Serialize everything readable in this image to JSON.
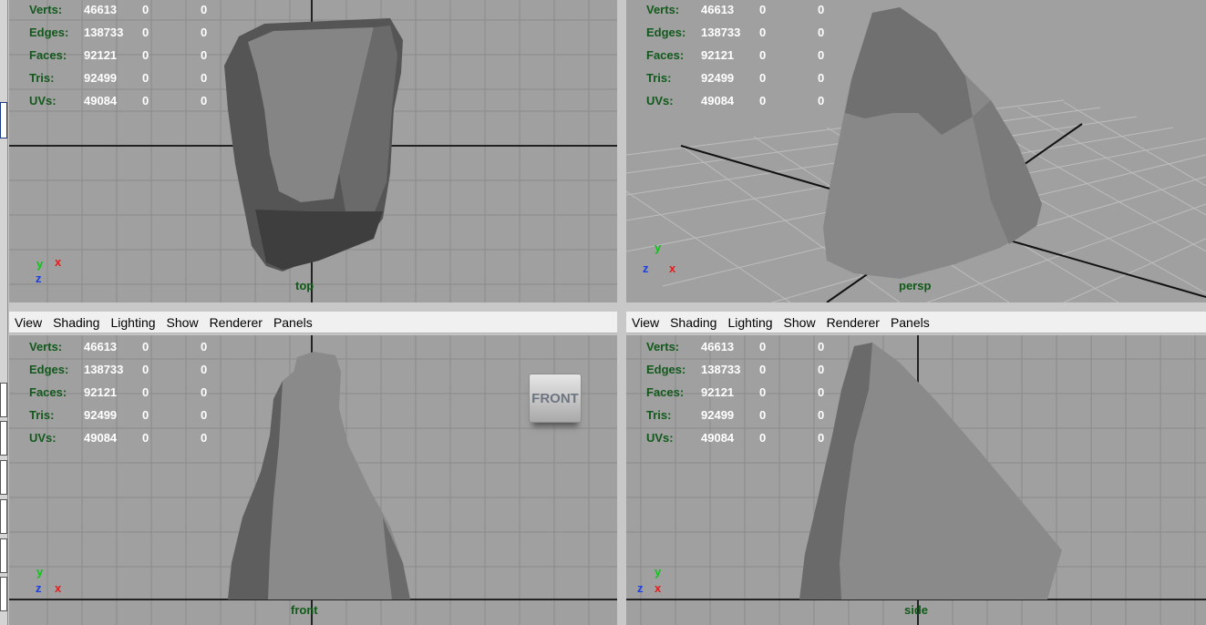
{
  "menu": [
    "View",
    "Shading",
    "Lighting",
    "Show",
    "Renderer",
    "Panels"
  ],
  "hud": {
    "labels": [
      "Verts:",
      "Edges:",
      "Faces:",
      "Tris:",
      "UVs:"
    ],
    "values": [
      [
        "46613",
        "0",
        "0"
      ],
      [
        "138733",
        "0",
        "0"
      ],
      [
        "92121",
        "0",
        "0"
      ],
      [
        "92499",
        "0",
        "0"
      ],
      [
        "49084",
        "0",
        "0"
      ]
    ]
  },
  "panes": {
    "top": {
      "camera": "top",
      "axis1": "y",
      "axis2": "x",
      "axis3": "z"
    },
    "persp": {
      "camera": "persp",
      "axis1": "y",
      "axis2": "z",
      "axis3": "x"
    },
    "front": {
      "camera": "front",
      "axis1": "y",
      "axis2": "z",
      "axis3": "x",
      "viewcube": "FRONT"
    },
    "side": {
      "camera": "side",
      "axis1": "y",
      "axis2": "z",
      "axis3": "x"
    }
  },
  "colors": {
    "hud_label": "#12591c",
    "hud_value": "#ffffff",
    "viewport_bg": "#a0a0a0",
    "axis_y": "#12c21d",
    "axis_x": "#e02020",
    "axis_z": "#1a3ee0"
  },
  "icons": [
    "rock-mesh",
    "view-cube"
  ]
}
